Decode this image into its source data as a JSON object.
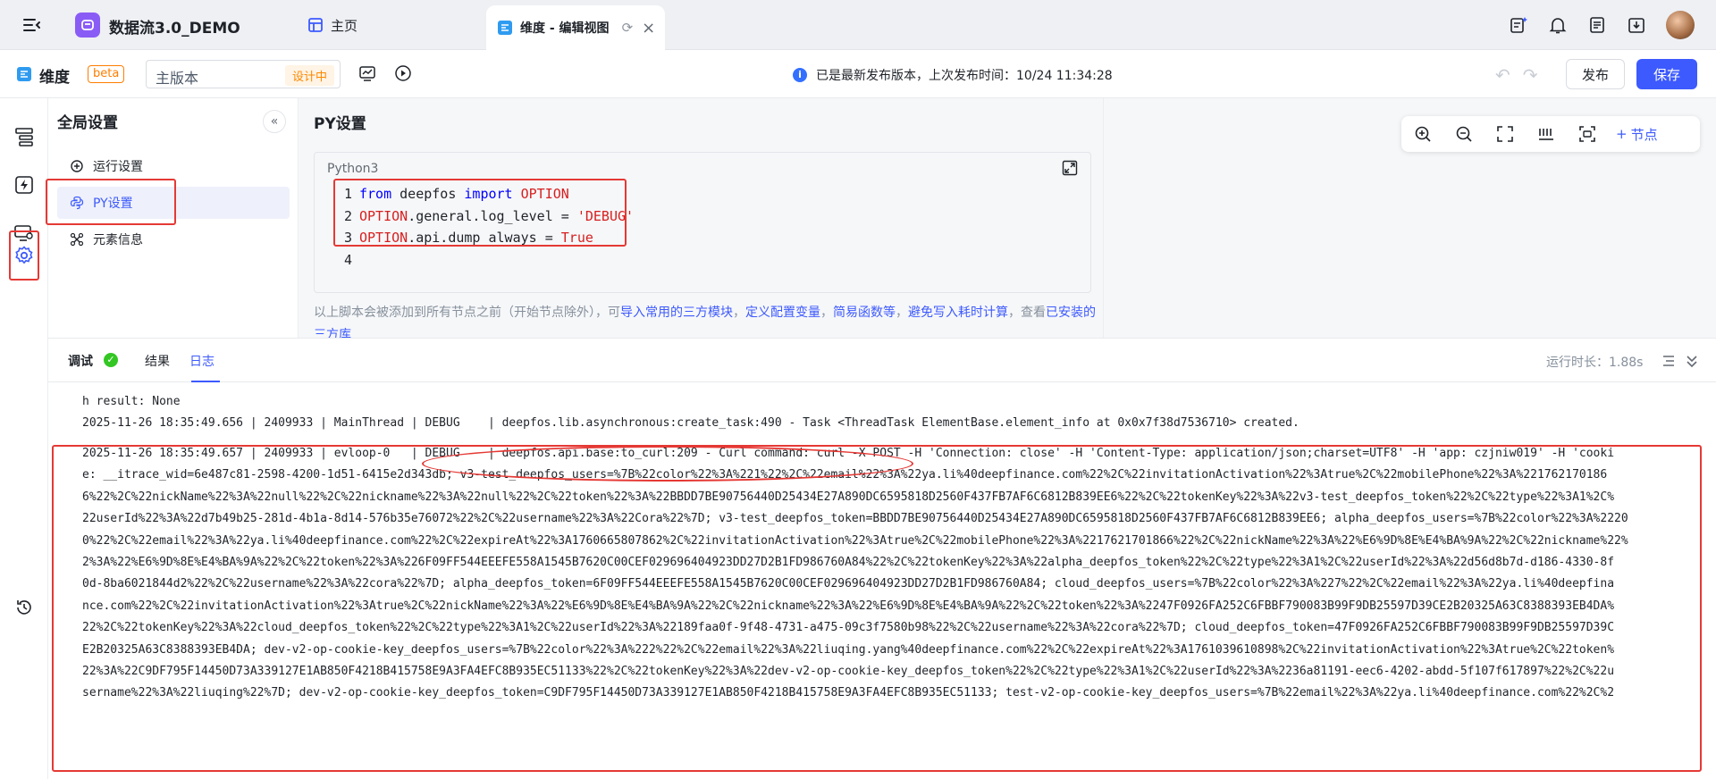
{
  "app": {
    "title": "数据流3.0_DEMO",
    "logo_color": "#8a5cf6"
  },
  "tabs": [
    {
      "label": "主页"
    },
    {
      "label": "维度 - 编辑视图"
    }
  ],
  "editor": {
    "module": "维度",
    "beta": "beta",
    "version": "主版本",
    "design_status": "设计中",
    "publish_status": "已是最新发布版本，上次发布时间：10/24 11:34:28",
    "publish_label": "发布",
    "save_label": "保存"
  },
  "global_settings": {
    "title": "全局设置",
    "items": [
      {
        "label": "运行设置",
        "icon": "run-settings-icon"
      },
      {
        "label": "PY设置",
        "icon": "python-icon"
      },
      {
        "label": "元素信息",
        "icon": "element-info-icon"
      }
    ]
  },
  "py_settings": {
    "title": "PY设置",
    "language": "Python3",
    "code": [
      {
        "n": "1"
      },
      {
        "n": "2"
      },
      {
        "n": "3"
      },
      {
        "n": "4"
      }
    ],
    "tokens": {
      "from": "from",
      "mod": "deepfos",
      "import": "import",
      "option": "OPTION",
      "l2_attr": ".general.log_level = ",
      "l2_val": "'DEBUG'",
      "l3_attr": ".api.dump_always = ",
      "l3_val": "True"
    },
    "help_prefix": "以上脚本会被添加到所有节点之前（开始节点除外），可",
    "help_link1": "导入常用的三方模块",
    "help_sep1": "，",
    "help_link2": "定义配置变量",
    "help_sep2": "，",
    "help_link3": "简易函数等",
    "help_sep3": "，",
    "help_link4": "避免写入耗时计算",
    "help_mid": "，查看",
    "help_link5": "已安装的三方库"
  },
  "canvas": {
    "add_node_label": "节点"
  },
  "debug": {
    "tab_debug": "调试",
    "tab_result": "结果",
    "tab_log": "日志",
    "run_time": "运行时长：1.88s",
    "log_line_0": "h result: None",
    "log_line_1": "2025-11-26 18:35:49.656 | 2409933 | MainThread | DEBUG    | deepfos.lib.asynchronous:create_task:490 - Task <ThreadTask ElementBase.element_info at 0x0x7f38d7536710> created.",
    "log_rows": [
      "2025-11-26 18:35:49.657 | 2409933 | evloop-0   | DEBUG    | deepfos.api.base:to_curl:209 - Curl command: curl -X POST -H 'Connection: close' -H 'Content-Type: application/json;charset=UTF8' -H 'app: czjniw019' -H 'cooki",
      "e: __itrace_wid=6e487c81-2598-4200-1d51-6415e2d343db; v3-test_deepfos_users=%7B%22color%22%3A%221%22%2C%22email%22%3A%22ya.li%40deepfinance.com%22%2C%22invitationActivation%22%3Atrue%2C%22mobilePhone%22%3A%221762170186",
      "6%22%2C%22nickName%22%3A%22null%22%2C%22nickname%22%3A%22null%22%2C%22token%22%3A%22BBDD7BE90756440D25434E27A890DC6595818D2560F437FB7AF6C6812B839EE6%22%2C%22tokenKey%22%3A%22v3-test_deepfos_token%22%2C%22type%22%3A1%2C%",
      "22userId%22%3A%22d7b49b25-281d-4b1a-8d14-576b35e76072%22%2C%22username%22%3A%22Cora%22%7D; v3-test_deepfos_token=BBDD7BE90756440D25434E27A890DC6595818D2560F437FB7AF6C6812B839EE6; alpha_deepfos_users=%7B%22color%22%3A%2220",
      "0%22%2C%22email%22%3A%22ya.li%40deepfinance.com%22%2C%22expireAt%22%3A1760665807862%2C%22invitationActivation%22%3Atrue%2C%22mobilePhone%22%3A%2217621701866%22%2C%22nickName%22%3A%22%E6%9D%8E%E4%BA%9A%22%2C%22nickname%22%",
      "2%3A%22%E6%9D%8E%E4%BA%9A%22%2C%22token%22%3A%226F09FF544EEEFE558A1545B7620C00CEF029696404923DD27D2B1FD986760A84%22%2C%22tokenKey%22%3A%22alpha_deepfos_token%22%2C%22type%22%3A1%2C%22userId%22%3A%22d56d8b7d-d186-4330-8f",
      "0d-8ba6021844d2%22%2C%22username%22%3A%22cora%22%7D; alpha_deepfos_token=6F09FF544EEEFE558A1545B7620C00CEF029696404923DD27D2B1FD986760A84; cloud_deepfos_users=%7B%22color%22%3A%227%22%2C%22email%22%3A%22ya.li%40deepfina",
      "nce.com%22%2C%22invitationActivation%22%3Atrue%2C%22nickName%22%3A%22%E6%9D%8E%E4%BA%9A%22%2C%22nickname%22%3A%22%E6%9D%8E%E4%BA%9A%22%2C%22token%22%3A%2247F0926FA252C6FBBF790083B99F9DB25597D39CE2B20325A63C8388393EB4DA%",
      "22%2C%22tokenKey%22%3A%22cloud_deepfos_token%22%2C%22type%22%3A1%2C%22userId%22%3A%22189faa0f-9f48-4731-a475-09c3f7580b98%22%2C%22username%22%3A%22cora%22%7D; cloud_deepfos_token=47F0926FA252C6FBBF790083B99F9DB25597D39C",
      "E2B20325A63C8388393EB4DA; dev-v2-op-cookie-key_deepfos_users=%7B%22color%22%3A%222%22%2C%22email%22%3A%22liuqing.yang%40deepfinance.com%22%2C%22expireAt%22%3A1761039610898%2C%22invitationActivation%22%3Atrue%2C%22token%",
      "22%3A%22C9DF795F14450D73A339127E1AB850F4218B415758E9A3FA4EFC8B935EC51133%22%2C%22tokenKey%22%3A%22dev-v2-op-cookie-key_deepfos_token%22%2C%22type%22%3A1%2C%22userId%22%3A%2236a81191-eec6-4202-abdd-5f107f617897%22%2C%22u",
      "sername%22%3A%22liuqing%22%7D; dev-v2-op-cookie-key_deepfos_token=C9DF795F14450D73A339127E1AB850F4218B415758E9A3FA4EFC8B935EC51133; test-v2-op-cookie-key_deepfos_users=%7B%22email%22%3A%22ya.li%40deepfinance.com%22%2C%2"
    ]
  }
}
